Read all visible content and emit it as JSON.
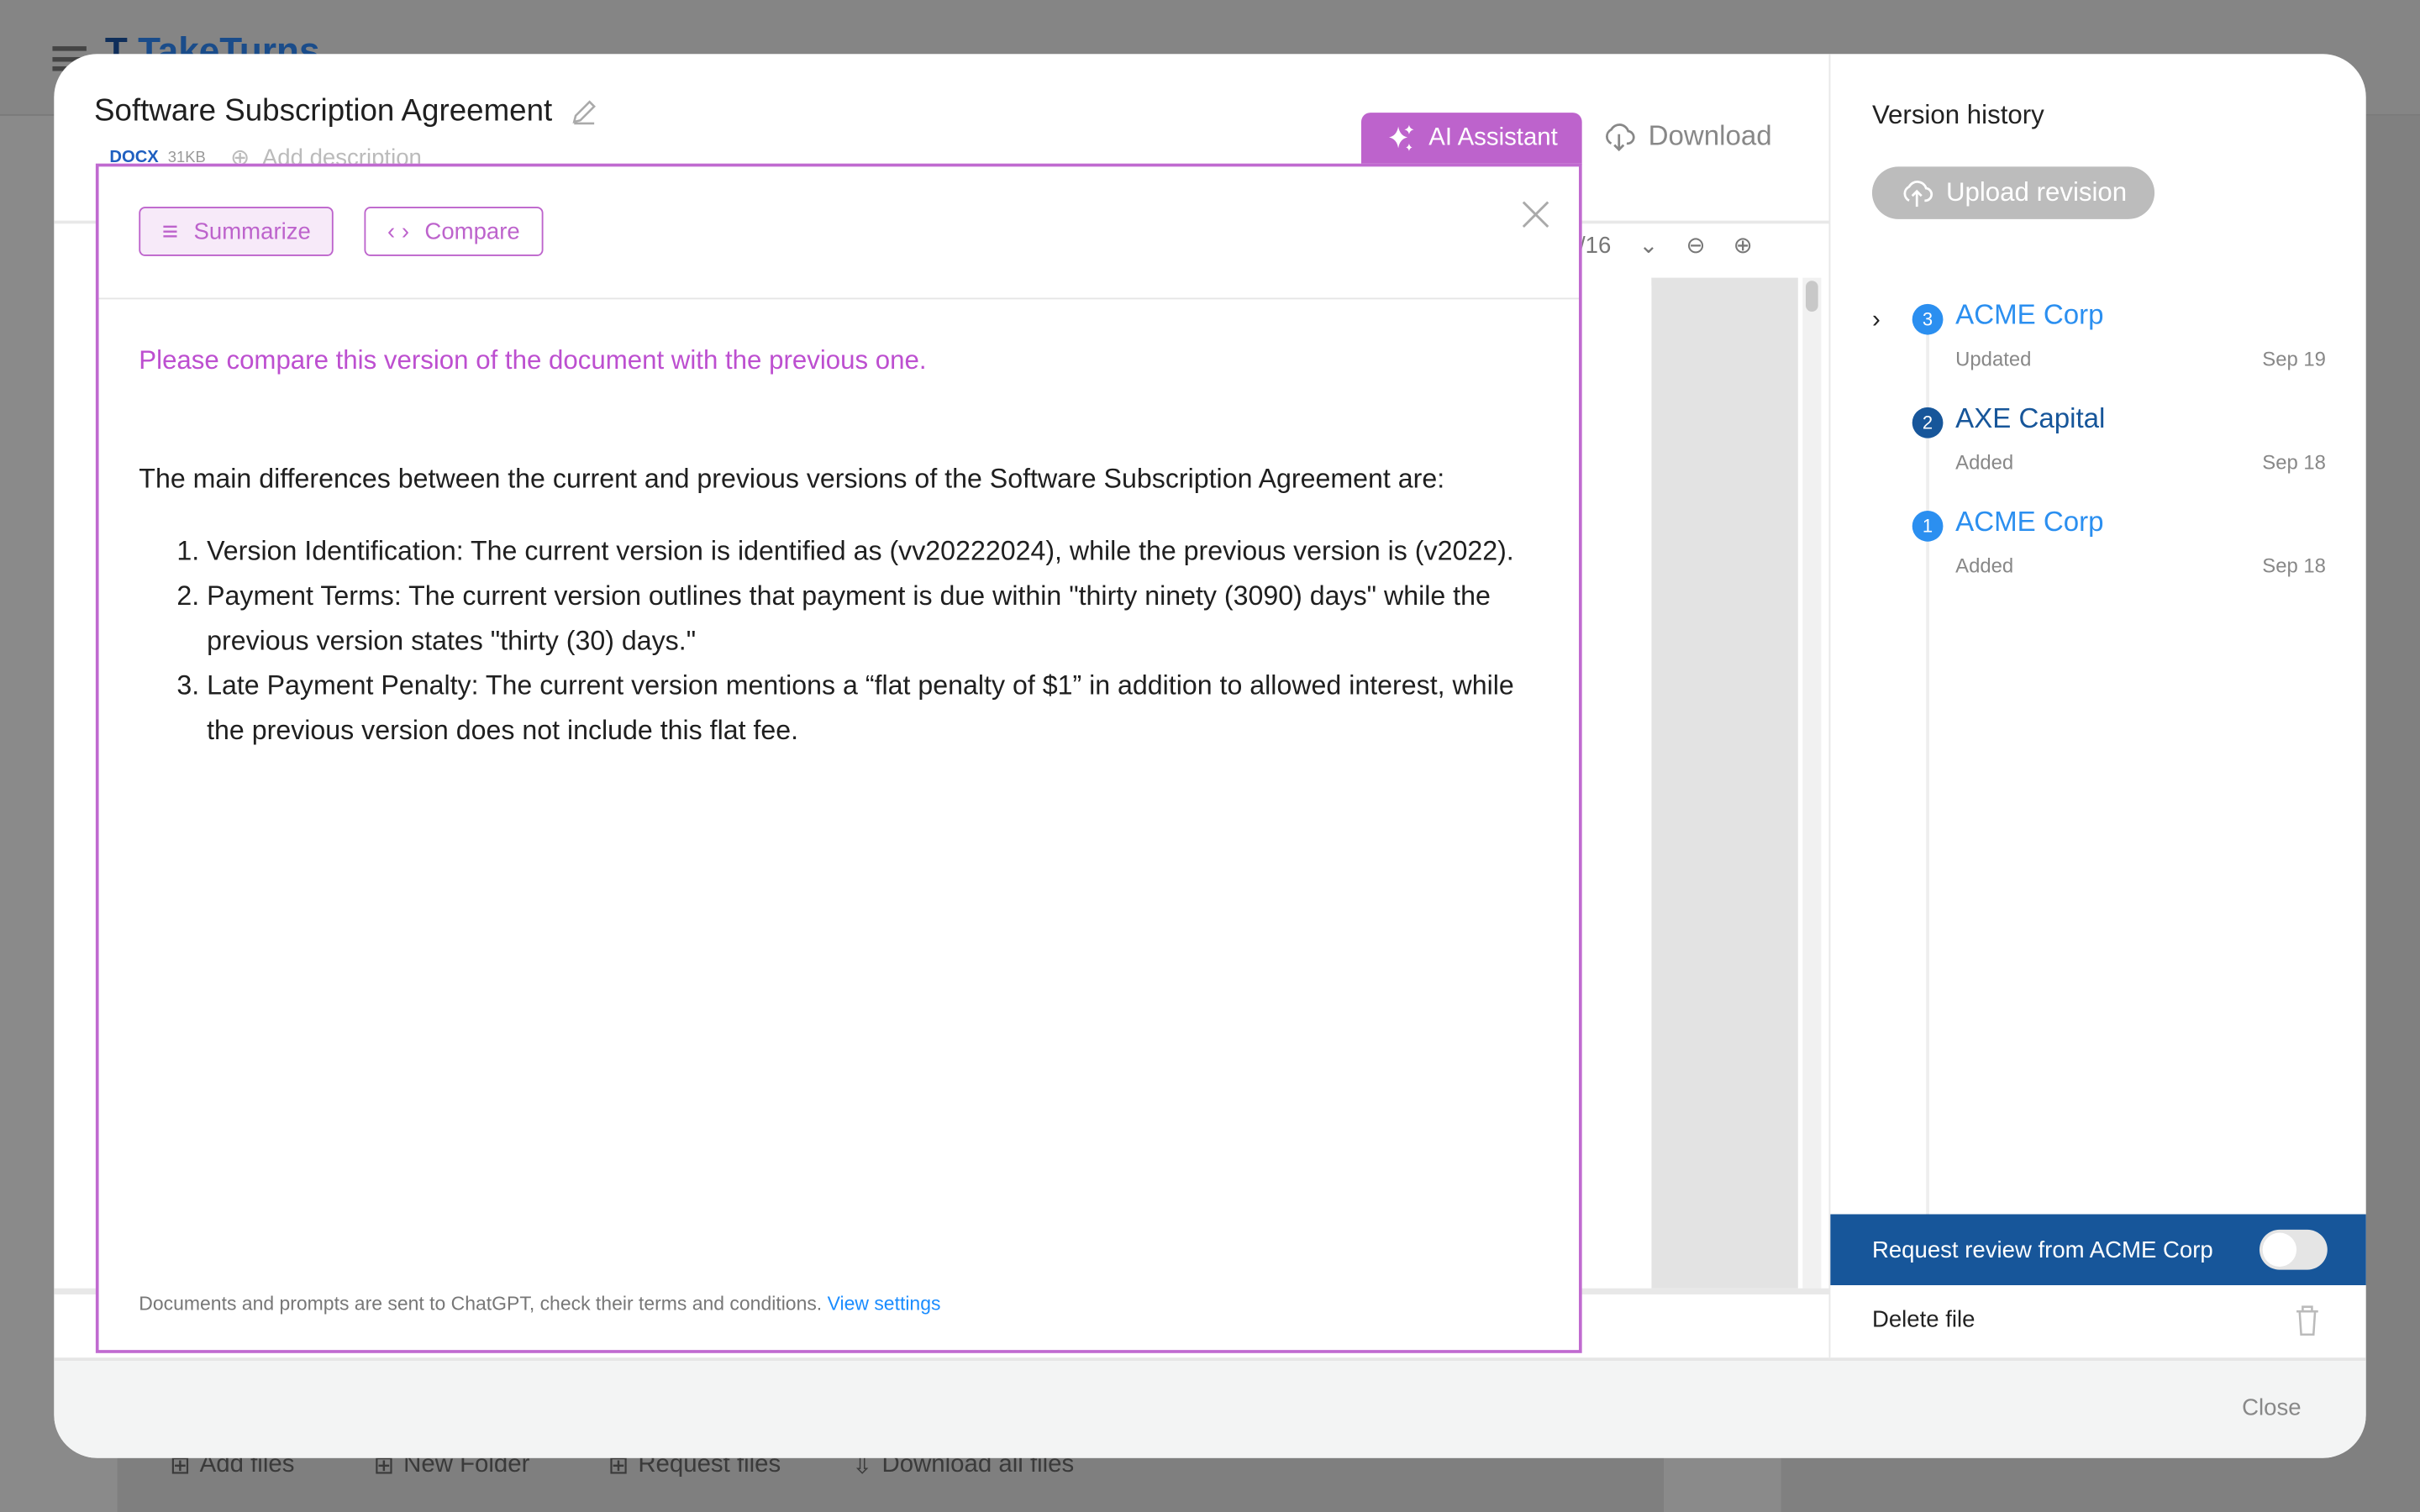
{
  "background": {
    "logo": "TakeTurns",
    "bottom_actions": [
      "Add files",
      "New Folder",
      "Request files",
      "Download all files"
    ]
  },
  "document": {
    "title": "Software Subscription Agreement",
    "type": "DOCX",
    "size": "31KB",
    "add_description": "Add description"
  },
  "toolbar": {
    "ai_assistant": "AI Assistant",
    "download": "Download",
    "page_suffix": "/16"
  },
  "ai_panel": {
    "summarize": "Summarize",
    "compare": "Compare",
    "prompt": "Please compare this version of the document with the previous one.",
    "answer_intro": "The main differences between the current and previous versions of the Software Subscription Agreement are:",
    "answer_items": [
      "Version Identification: The current version is identified as (vv20222024), while the previous version is (v2022).",
      "Payment Terms: The current version outlines that payment is due within \"thirty ninety (3090) days\" while the previous version states \"thirty (30) days.\"",
      "Late Payment Penalty: The current version mentions a “flat penalty of $1” in addition to allowed interest, while the previous version does not include this flat fee."
    ],
    "disclaimer": "Documents and prompts are sent to ChatGPT, check their terms and conditions.",
    "view_settings": "View settings"
  },
  "version_history": {
    "title": "Version history",
    "upload": "Upload revision",
    "versions": [
      {
        "num": "3",
        "name": "ACME Corp",
        "action": "Updated",
        "date": "Sep 19",
        "color": "#2b8ff0"
      },
      {
        "num": "2",
        "name": "AXE Capital",
        "action": "Added",
        "date": "Sep 18",
        "color": "#17569a"
      },
      {
        "num": "1",
        "name": "ACME Corp",
        "action": "Added",
        "date": "Sep 18",
        "color": "#2b8ff0"
      }
    ],
    "request_review": "Request review from ACME Corp",
    "request_review_on": false,
    "delete": "Delete file"
  },
  "footer": {
    "close": "Close"
  },
  "colors": {
    "accent": "#bd63cc",
    "primary": "#17569a",
    "link": "#2b8ff0"
  }
}
